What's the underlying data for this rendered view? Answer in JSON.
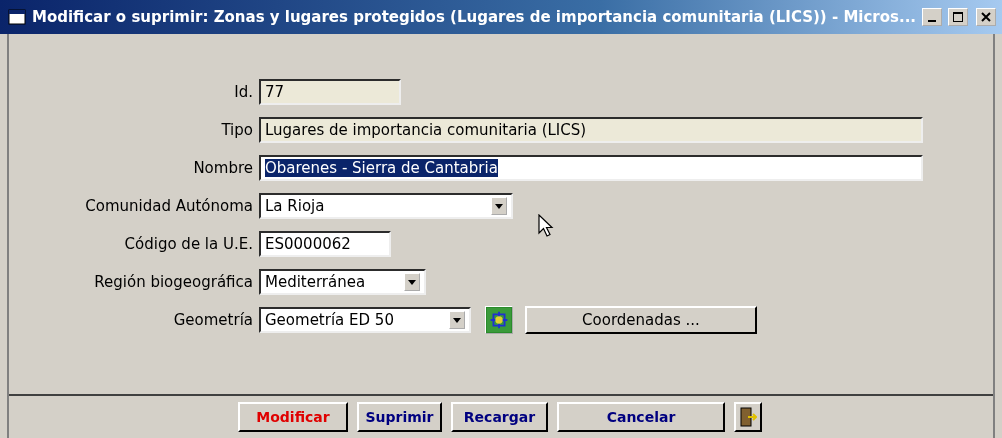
{
  "window": {
    "title": "Modificar o suprimir: Zonas y lugares protegidos (Lugares de importancia comunitaria (LICS)) - Micros..."
  },
  "fields": [
    {
      "label": "Id.",
      "kind": "text",
      "value": "77",
      "readonly": true,
      "text_selected": false
    },
    {
      "label": "Tipo",
      "kind": "text",
      "value": "Lugares de importancia comunitaria (LICS)",
      "readonly": true,
      "text_selected": false
    },
    {
      "label": "Nombre",
      "kind": "text",
      "value": "Obarenes - Sierra de Cantabria",
      "readonly": false,
      "text_selected": true
    },
    {
      "label": "Comunidad Autónoma",
      "kind": "select",
      "value": "La Rioja",
      "readonly": false,
      "text_selected": false
    },
    {
      "label": "Código de la U.E.",
      "kind": "text",
      "value": "ES0000062",
      "readonly": false,
      "text_selected": false
    },
    {
      "label": "Región biogeográfica",
      "kind": "select",
      "value": "Mediterránea",
      "readonly": false,
      "text_selected": false
    },
    {
      "label": "Geometría",
      "kind": "select",
      "value": "Geometría ED 50",
      "readonly": false,
      "text_selected": false,
      "action": "Coordenadas ..."
    }
  ],
  "buttons": [
    {
      "label": "Modificar",
      "default": true
    },
    {
      "label": "Suprimir",
      "default": false
    },
    {
      "label": "Recargar",
      "default": false
    },
    {
      "label": "Cancelar",
      "default": false
    }
  ]
}
